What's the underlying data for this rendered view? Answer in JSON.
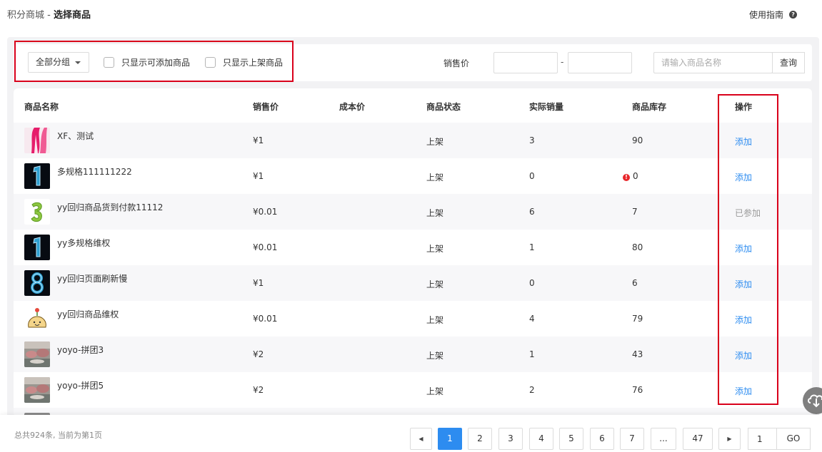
{
  "header": {
    "app": "积分商城",
    "separator": " - ",
    "current": "选择商品",
    "guide_label": "使用指南",
    "guide_icon": "?"
  },
  "filter": {
    "group_select": "全部分组",
    "only_addable": "只显示可添加商品",
    "only_on_shelf": "只显示上架商品",
    "price_label": "销售价",
    "price_dash": "-",
    "price_min_value": "",
    "price_max_value": "",
    "search_placeholder": "请输入商品名称",
    "search_value": "",
    "search_button": "查询"
  },
  "table": {
    "columns": [
      "商品名称",
      "销售价",
      "成本价",
      "商品状态",
      "实际销量",
      "商品库存",
      "操作"
    ],
    "rows": [
      {
        "name": "XF、测试",
        "price": "¥1",
        "cost": "",
        "status": "上架",
        "sales": "3",
        "stock": "90",
        "stock_warning": false,
        "action": "添加",
        "added": false,
        "thumb": "pink-feather"
      },
      {
        "name": "多规格111111222",
        "price": "¥1",
        "cost": "",
        "status": "上架",
        "sales": "0",
        "stock": "0",
        "stock_warning": true,
        "action": "添加",
        "added": false,
        "thumb": "balloon-1"
      },
      {
        "name": "yy回归商品货到付款11112",
        "price": "¥0.01",
        "cost": "",
        "status": "上架",
        "sales": "6",
        "stock": "7",
        "stock_warning": false,
        "action": "已参加",
        "added": true,
        "thumb": "green-3"
      },
      {
        "name": "yy多规格维权",
        "price": "¥0.01",
        "cost": "",
        "status": "上架",
        "sales": "1",
        "stock": "80",
        "stock_warning": false,
        "action": "添加",
        "added": false,
        "thumb": "balloon-1"
      },
      {
        "name": "yy回归页面刷新慢",
        "price": "¥1",
        "cost": "",
        "status": "上架",
        "sales": "0",
        "stock": "6",
        "stock_warning": false,
        "action": "添加",
        "added": false,
        "thumb": "balloon-8"
      },
      {
        "name": "yy回归商品维权",
        "price": "¥0.01",
        "cost": "",
        "status": "上架",
        "sales": "4",
        "stock": "79",
        "stock_warning": false,
        "action": "添加",
        "added": false,
        "thumb": "cartoon"
      },
      {
        "name": "yoyo-拼团3",
        "price": "¥2",
        "cost": "",
        "status": "上架",
        "sales": "1",
        "stock": "43",
        "stock_warning": false,
        "action": "添加",
        "added": false,
        "thumb": "photo"
      },
      {
        "name": "yoyo-拼团5",
        "price": "¥2",
        "cost": "",
        "status": "上架",
        "sales": "2",
        "stock": "76",
        "stock_warning": false,
        "action": "添加",
        "added": false,
        "thumb": "photo"
      }
    ],
    "warning_icon": "!"
  },
  "pagination": {
    "summary": "总共924条, 当前为第1页",
    "prev_icon": "◀",
    "next_icon": "▶",
    "pages": [
      "1",
      "2",
      "3",
      "4",
      "5",
      "6",
      "7",
      "...",
      "47"
    ],
    "active_page": "1",
    "goto_value": "1",
    "go_label": "GO"
  },
  "colors": {
    "accent": "#2d8cf0",
    "highlight_border": "#d9001b",
    "warning": "#e8262b"
  }
}
